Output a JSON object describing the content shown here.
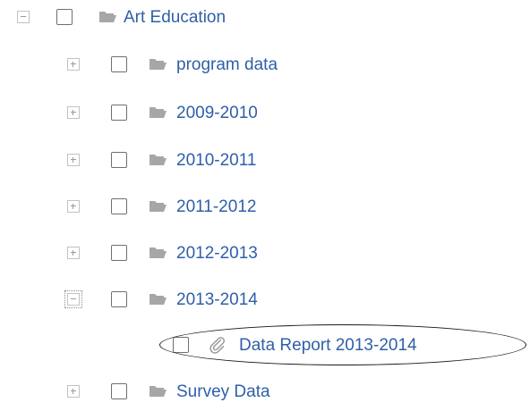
{
  "tree": {
    "root": {
      "label": "Art Education",
      "expanded": true,
      "checked": false,
      "icon": "folder-icon"
    },
    "children": [
      {
        "label": "program data",
        "expanded": false,
        "checked": false,
        "icon": "folder-icon"
      },
      {
        "label": "2009-2010",
        "expanded": false,
        "checked": false,
        "icon": "folder-icon"
      },
      {
        "label": "2010-2011",
        "expanded": false,
        "checked": false,
        "icon": "folder-icon"
      },
      {
        "label": "2011-2012",
        "expanded": false,
        "checked": false,
        "icon": "folder-icon"
      },
      {
        "label": "2012-2013",
        "expanded": false,
        "checked": false,
        "icon": "folder-icon"
      },
      {
        "label": "2013-2014",
        "expanded": true,
        "checked": false,
        "icon": "folder-icon",
        "children": [
          {
            "label": "Data Report 2013-2014",
            "checked": false,
            "icon": "paperclip-icon",
            "highlighted": true
          }
        ]
      },
      {
        "label": "Survey Data",
        "expanded": false,
        "checked": false,
        "icon": "folder-icon"
      }
    ]
  },
  "colors": {
    "link": "#2f5fa9",
    "folder": "#a6a6a6",
    "checkbox_border": "#6f6f6f",
    "expander_border": "#c2c2c2",
    "annotation": "#1a1a1a"
  }
}
